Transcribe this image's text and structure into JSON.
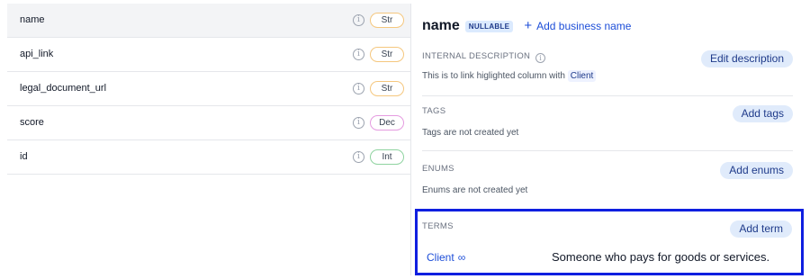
{
  "columns": [
    {
      "name": "name",
      "type": "Str",
      "selected": true
    },
    {
      "name": "api_link",
      "type": "Str"
    },
    {
      "name": "legal_document_url",
      "type": "Str"
    },
    {
      "name": "score",
      "type": "Dec"
    },
    {
      "name": "id",
      "type": "Int"
    }
  ],
  "detail": {
    "title": "name",
    "nullable_badge": "NULLABLE",
    "add_business_name": "Add business name",
    "internal_description": {
      "label": "INTERNAL DESCRIPTION",
      "button": "Edit description",
      "text_prefix": "This is to link higlighted column with",
      "text_tag": "Client"
    },
    "tags": {
      "label": "TAGS",
      "button": "Add tags",
      "text": "Tags are not created yet"
    },
    "enums": {
      "label": "ENUMS",
      "button": "Add enums",
      "text": "Enums are not created yet"
    },
    "terms": {
      "label": "TERMS",
      "button": "Add term",
      "term_name": "Client",
      "term_definition": "Someone who pays for goods or services."
    }
  },
  "colors": {
    "accent": "#1d4ed8",
    "highlight_box": "#0f1fe0",
    "str_badge": "#f5c77e",
    "dec_badge": "#e59be0",
    "int_badge": "#8fd3a0"
  }
}
